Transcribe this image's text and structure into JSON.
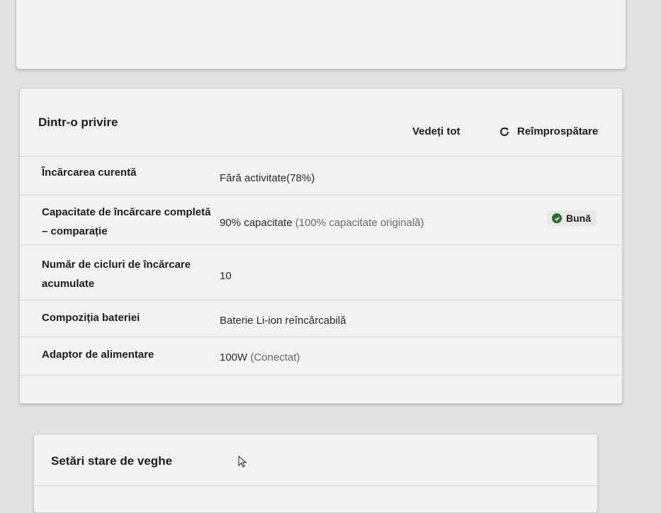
{
  "summary": {
    "title": "Dintr-o privire",
    "view_all_label": "Vedeți tot",
    "refresh_label": "Reîmprospătare",
    "refresh_icon": "refresh-icon"
  },
  "rows": [
    {
      "label": "Încărcarea curentă",
      "value": "Fără activitate(78%)"
    },
    {
      "label": "Capacitate de încărcare completă – comparație",
      "value": "90% capacitate",
      "value_extra": "(100% capacitate originală)",
      "badge": "Bună",
      "badge_color": "#2f6b2b"
    },
    {
      "label": "Număr de cicluri de încărcare acumulate",
      "value": "10"
    },
    {
      "label": "Compoziția bateriei",
      "value": "Baterie Li-ion reîncărcabilă"
    },
    {
      "label": "Adaptor de alimentare",
      "value": "100W",
      "value_extra": "(Conectat)"
    }
  ],
  "sleep": {
    "title": "Setări stare de veghe"
  }
}
